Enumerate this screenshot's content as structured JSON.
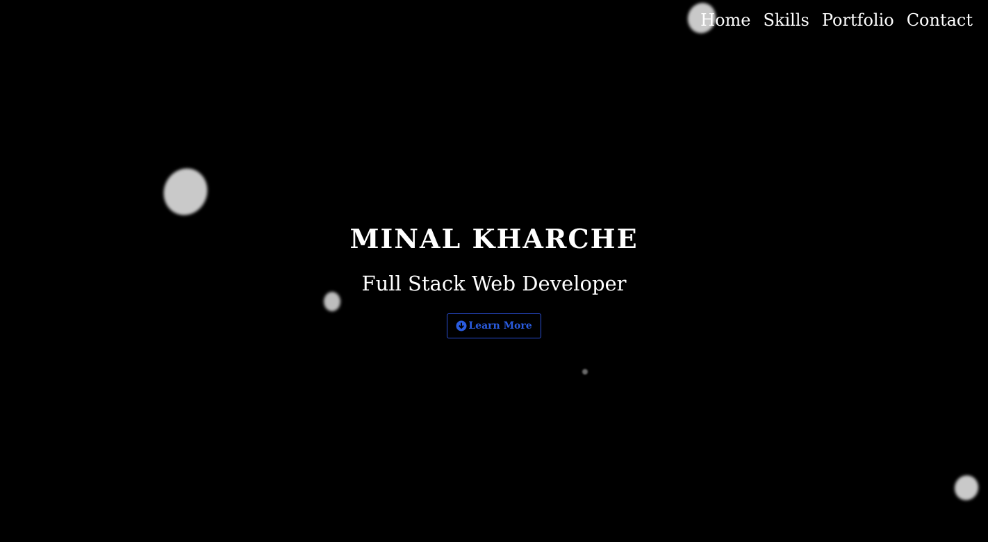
{
  "nav": {
    "items": [
      {
        "label": "Home"
      },
      {
        "label": "Skills"
      },
      {
        "label": "Portfolio"
      },
      {
        "label": "Contact"
      }
    ]
  },
  "hero": {
    "name": "MINAL KHARCHE",
    "role": "Full Stack Web Developer",
    "cta": {
      "label": "Learn More",
      "icon": "arrow-down-circle-icon"
    }
  },
  "colors": {
    "background": "#000000",
    "text": "#ffffff",
    "accent": "#2a5ce0"
  }
}
